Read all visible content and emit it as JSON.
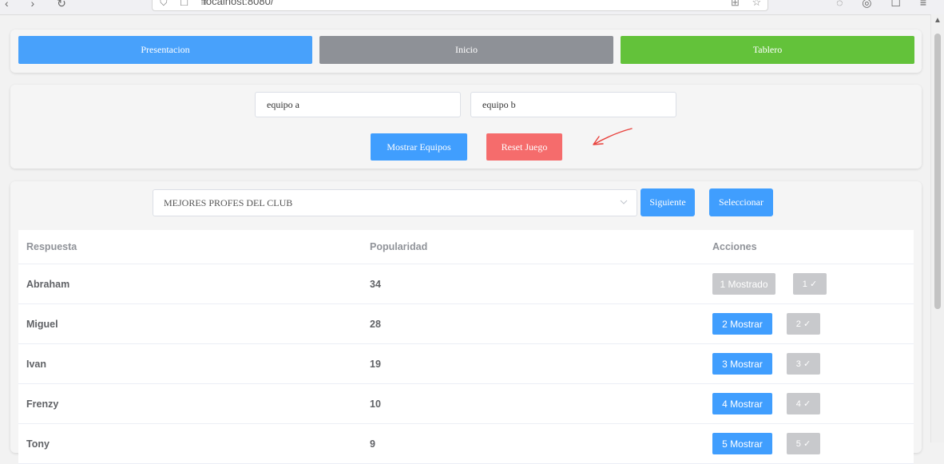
{
  "browser": {
    "url": "localhost:8080/",
    "nav_icons": "‹ › ↻",
    "url_icons": "⛉ ☐ ≡",
    "ext_icons": "⊞ ☆",
    "right_icons": "◌ ◎ ☐ ≡"
  },
  "nav": {
    "presentacion": "Presentacion",
    "inicio": "Inicio",
    "tablero": "Tablero"
  },
  "teams": {
    "team_a": "equipo a",
    "team_b": "equipo b",
    "mostrar_label": "Mostrar Equipos",
    "reset_label": "Reset Juego"
  },
  "question": {
    "selected": "MEJORES PROFES DEL CLUB",
    "siguiente_label": "Siguiente",
    "seleccionar_label": "Seleccionar"
  },
  "table": {
    "headers": [
      "Respuesta",
      "Popularidad",
      "Acciones"
    ],
    "rows": [
      {
        "respuesta": "Abraham",
        "popularidad": "34",
        "show_label": "1 Mostrado",
        "ok_label": "1 ✓",
        "shown": true
      },
      {
        "respuesta": "Miguel",
        "popularidad": "28",
        "show_label": "2 Mostrar",
        "ok_label": "2 ✓",
        "shown": false
      },
      {
        "respuesta": "Ivan",
        "popularidad": "19",
        "show_label": "3 Mostrar",
        "ok_label": "3 ✓",
        "shown": false
      },
      {
        "respuesta": "Frenzy",
        "popularidad": "10",
        "show_label": "4 Mostrar",
        "ok_label": "4 ✓",
        "shown": false
      },
      {
        "respuesta": "Tony",
        "popularidad": "9",
        "show_label": "5 Mostrar",
        "ok_label": "5 ✓",
        "shown": false
      }
    ]
  },
  "colors": {
    "primary": "#409efe",
    "gray": "#8e9197",
    "success": "#63c23a",
    "danger": "#f56c6c",
    "disabled": "#c8c9cc",
    "annotation": "#e8413c"
  }
}
